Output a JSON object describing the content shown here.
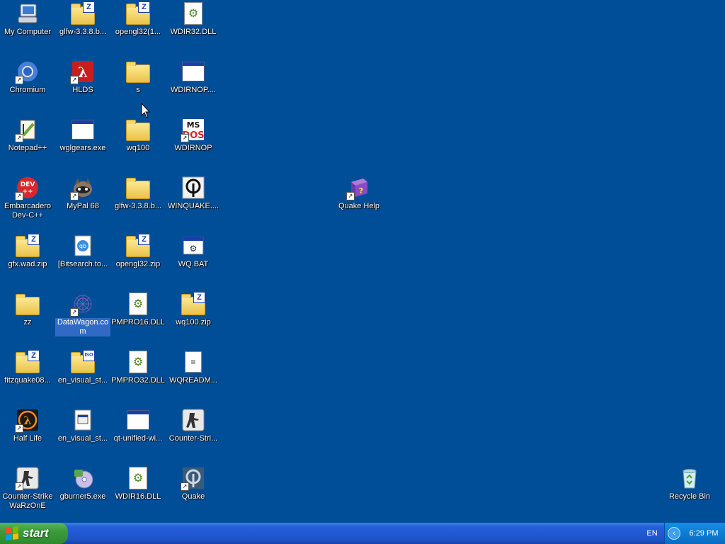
{
  "desktop": {
    "background_color": "#004e98",
    "icons": [
      {
        "label": "My Computer",
        "icon": "my-computer-icon"
      },
      {
        "label": "glfw-3.3.8.b...",
        "icon": "zip-folder-icon"
      },
      {
        "label": "opengl32(1...",
        "icon": "zip-folder-icon"
      },
      {
        "label": "WDIR32.DLL",
        "icon": "dll-icon"
      },
      {
        "label": "Chromium",
        "icon": "chromium-icon"
      },
      {
        "label": "HLDS",
        "icon": "half-life-icon"
      },
      {
        "label": "s",
        "icon": "folder-icon"
      },
      {
        "label": "WDIRNOP....",
        "icon": "application-window-icon"
      },
      {
        "label": "Notepad++",
        "icon": "notepad-plus-plus-icon"
      },
      {
        "label": "wglgears.exe",
        "icon": "application-window-icon"
      },
      {
        "label": "wq100",
        "icon": "folder-icon"
      },
      {
        "label": "WDIRNOP",
        "icon": "ms-dos-icon"
      },
      {
        "label": "Embarcadero Dev-C++",
        "icon": "dev-cpp-icon"
      },
      {
        "label": "MyPal 68",
        "icon": "mypal-raccoon-icon"
      },
      {
        "label": "glfw-3.3.8.b...",
        "icon": "folder-icon"
      },
      {
        "label": "WINQUAKE....",
        "icon": "quake-icon"
      },
      {
        "label": "Quake Help",
        "icon": "help-book-icon"
      },
      {
        "label": "gfx.wad.zip",
        "icon": "zip-folder-icon"
      },
      {
        "label": "[Bitsearch.to...",
        "icon": "qbittorrent-file-icon"
      },
      {
        "label": "opengl32.zip",
        "icon": "zip-folder-icon"
      },
      {
        "label": "WQ.BAT",
        "icon": "batch-file-icon"
      },
      {
        "label": "zz",
        "icon": "folder-icon"
      },
      {
        "label": "DataWagon.com",
        "icon": "datawagon-icon"
      },
      {
        "label": "PMPRO16.DLL",
        "icon": "dll-icon"
      },
      {
        "label": "wq100.zip",
        "icon": "zip-folder-icon"
      },
      {
        "label": "fitzquake08...",
        "icon": "zip-folder-icon"
      },
      {
        "label": "en_visual_st...",
        "icon": "iso-folder-icon"
      },
      {
        "label": "PMPRO32.DLL",
        "icon": "dll-icon"
      },
      {
        "label": "WQREADM...",
        "icon": "text-document-icon"
      },
      {
        "label": "Half Life",
        "icon": "half-life-icon"
      },
      {
        "label": "en_visual_st...",
        "icon": "installer-document-icon"
      },
      {
        "label": "qt-unified-wi...",
        "icon": "application-window-icon"
      },
      {
        "label": "Counter-Stri...",
        "icon": "counter-strike-icon"
      },
      {
        "label": "Counter-Strike WaRzOnE",
        "icon": "counter-strike-icon"
      },
      {
        "label": "gburner5.exe",
        "icon": "gburner-icon"
      },
      {
        "label": "WDIR16.DLL",
        "icon": "dll-icon"
      },
      {
        "label": "Quake",
        "icon": "quake-icon"
      },
      {
        "label": "Recycle Bin",
        "icon": "recycle-bin-icon"
      }
    ]
  },
  "taskbar": {
    "start_label": "start",
    "language": "EN",
    "clock": "6:29 PM",
    "tray_arrow": "‹"
  }
}
